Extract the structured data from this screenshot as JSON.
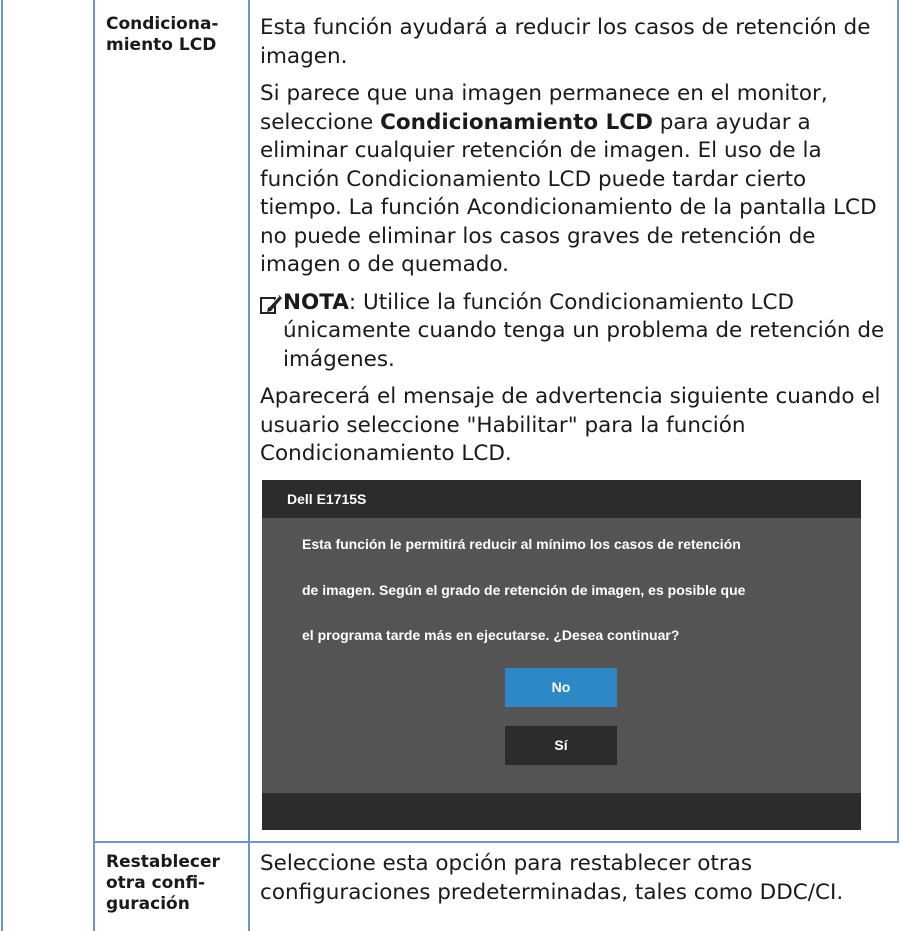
{
  "rows": [
    {
      "label": "Condiciona-\nmiento LCD",
      "paragraphs": {
        "p1": "Esta función ayudará a reducir los casos de retención de imagen.",
        "p2_before": "Si parece que una imagen permanece en el monitor, seleccione ",
        "p2_bold": "Condicionamiento LCD",
        "p2_after": " para ayudar a eliminar cualquier retención de imagen. El uso de la función Condicionamiento LCD puede tardar cierto tiempo. La función Acondicionamiento de la pantalla LCD no puede eliminar los casos graves de retención de imagen o de quemado.",
        "note_label": "NOTA",
        "note_text": ": Utilice la función Condicionamiento LCD únicamente cuando tenga un problema de retención de imágenes.",
        "p3": "Aparecerá el mensaje de advertencia siguiente cuando el usuario seleccione \"Habilitar\" para la función Condicionamiento LCD."
      },
      "note_icon": "pencil-icon",
      "osd": {
        "title": "Dell E1715S",
        "message_lines": [
          "Esta función le permitirá reducir al mínimo los casos de retención",
          "de imagen. Según el grado de retención de imagen, es posible que",
          "el programa tarde más en ejecutarse. ¿Desea continuar?"
        ],
        "buttons": {
          "no": "No",
          "yes": "Sí"
        },
        "colors": {
          "panel": "#545454",
          "bar": "#2c2c2c",
          "selected": "#2d88c6"
        }
      }
    },
    {
      "label": "Restablecer\notra confi-\nguración",
      "text": "Seleccione esta opción para restablecer otras configuraciones predeterminadas, tales como DDC/CI."
    }
  ],
  "colors": {
    "rule": "#6f96c8"
  }
}
